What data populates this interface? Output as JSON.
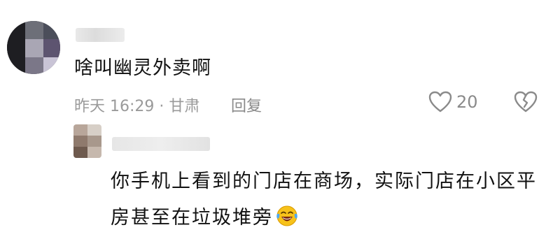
{
  "comment": {
    "text": "啥叫幽灵外卖啊",
    "meta": "昨天 16:29 · 甘肃",
    "reply_label": "回复",
    "like_count": "20"
  },
  "reply": {
    "text": "你手机上看到的门店在商场，实际门店在小区平房甚至在垃圾堆旁"
  },
  "icons": {
    "like": "heart-outline-icon",
    "dislike": "broken-heart-outline-icon",
    "emoji": "laughing-crying-emoji-icon"
  }
}
